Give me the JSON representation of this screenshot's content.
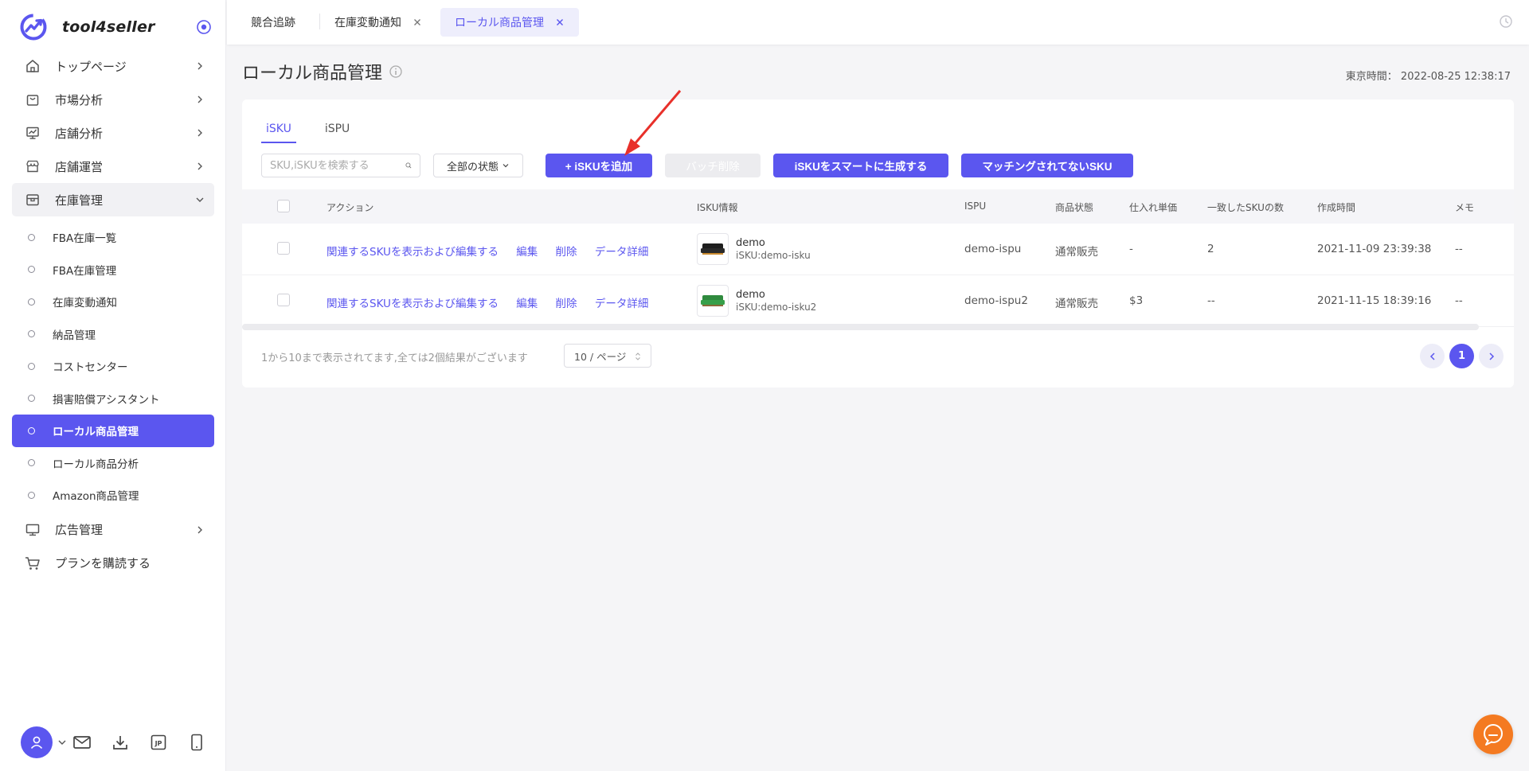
{
  "app": {
    "name": "tool4seller"
  },
  "sidebar": {
    "menu": [
      {
        "label": "トップページ",
        "icon": "home-icon"
      },
      {
        "label": "市場分析",
        "icon": "shopping-bag-icon"
      },
      {
        "label": "店舗分析",
        "icon": "chart-icon"
      },
      {
        "label": "店舗運営",
        "icon": "store-icon"
      },
      {
        "label": "在庫管理",
        "icon": "box-icon"
      }
    ],
    "submenu": [
      {
        "label": "FBA在庫一覧"
      },
      {
        "label": "FBA在庫管理"
      },
      {
        "label": "在庫変動通知"
      },
      {
        "label": "納品管理"
      },
      {
        "label": "コストセンター"
      },
      {
        "label": "損害賠償アシスタント"
      },
      {
        "label": "ローカル商品管理"
      },
      {
        "label": "ローカル商品分析"
      },
      {
        "label": "Amazon商品管理"
      }
    ],
    "menu_after": [
      {
        "label": "広告管理",
        "icon": "monitor-icon"
      },
      {
        "label": "プランを購読する",
        "icon": "cart-icon"
      }
    ],
    "footer_lang": "JP"
  },
  "top_tabs": [
    {
      "label": "競合追跡"
    },
    {
      "label": "在庫変動通知"
    },
    {
      "label": "ローカル商品管理"
    }
  ],
  "page": {
    "title": "ローカル商品管理",
    "time_label": "東京時間：",
    "time_value": "2022-08-25 12:38:17"
  },
  "content_tabs": [
    {
      "label": "iSKU"
    },
    {
      "label": "iSPU"
    }
  ],
  "toolbar": {
    "search_placeholder": "SKU,iSKUを検索する",
    "status_select": "全部の状態",
    "add_button": "+ iSKUを追加",
    "batch_delete_button": "バッチ削除",
    "smart_generate_button": "iSKUをスマートに生成する",
    "unmatched_button": "マッチングされてないSKU"
  },
  "table": {
    "headers": [
      "アクション",
      "ISKU情報",
      "ISPU",
      "商品状態",
      "仕入れ単価",
      "一致したSKUの数",
      "作成時間",
      "メモ"
    ],
    "action_links": [
      "関連するSKUを表示および編集する",
      "編集",
      "削除",
      "データ詳細"
    ],
    "rows": [
      {
        "name": "demo",
        "isku": "iSKU:demo-isku",
        "ispu": "demo-ispu",
        "status": "通常販売",
        "price": "-",
        "matched": "2",
        "created": "2021-11-09 23:39:38",
        "memo": "--"
      },
      {
        "name": "demo",
        "isku": "iSKU:demo-isku2",
        "ispu": "demo-ispu2",
        "status": "通常販売",
        "price": "$3",
        "matched": "--",
        "created": "2021-11-15 18:39:16",
        "memo": "--"
      }
    ]
  },
  "footer": {
    "summary": "1から10まで表示されてます,全ては2個結果がございます",
    "page_size": "10 / ページ",
    "current_page": "1"
  },
  "colors": {
    "accent": "#5b56ef",
    "chat": "#f47a21",
    "annotation": "#e8302a"
  }
}
